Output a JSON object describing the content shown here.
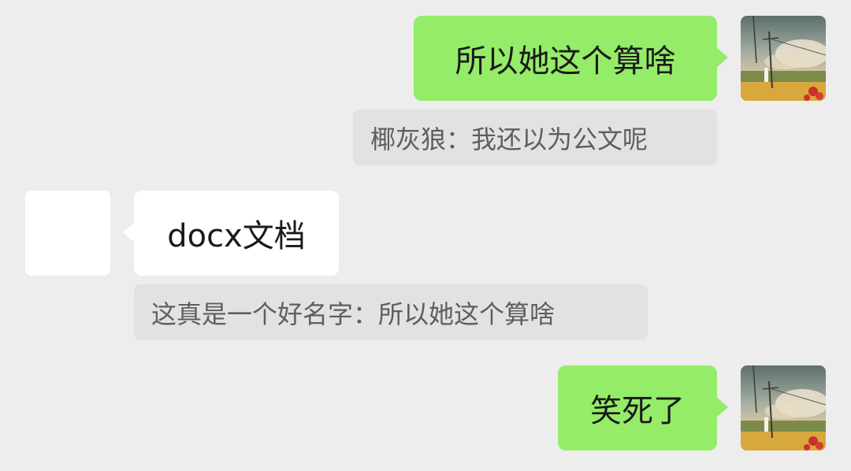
{
  "messages": [
    {
      "sender": "self",
      "text": "所以她这个算啥"
    },
    {
      "quote": "椰灰狼：我还以为公文呢"
    },
    {
      "sender": "other",
      "text": "docx文档"
    },
    {
      "quote": "这真是一个好名字：所以她这个算啥"
    },
    {
      "sender": "self",
      "text": "笑死了"
    }
  ],
  "colors": {
    "background": "#ededed",
    "outgoing_bubble": "#95ec69",
    "incoming_bubble": "#ffffff",
    "quote_background": "#e2e2e2",
    "quote_text": "#5e5e5e"
  }
}
